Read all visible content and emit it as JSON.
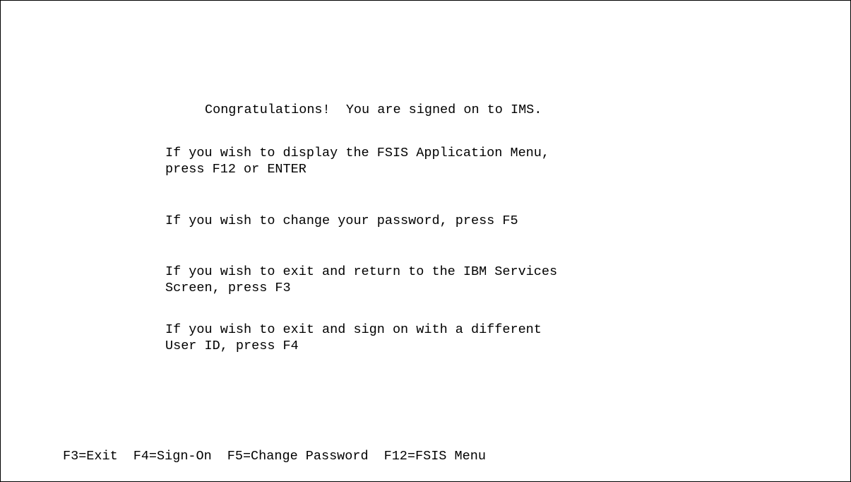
{
  "title": "Congratulations!  You are signed on to IMS.",
  "instructions": [
    {
      "line1": "If you wish to display the FSIS Application Menu,",
      "line2": "press F12 or ENTER"
    },
    {
      "line1": "If you wish to change your password, press F5",
      "line2": ""
    },
    {
      "line1": "If you wish to exit and return to the IBM Services",
      "line2": "Screen, press F3"
    },
    {
      "line1": "If you wish to exit and sign on with a different",
      "line2": "User ID, press F4"
    }
  ],
  "function_keys": [
    {
      "label": "F3=Exit"
    },
    {
      "label": "F4=Sign-On"
    },
    {
      "label": "F5=Change Password"
    },
    {
      "label": "F12=FSIS Menu"
    }
  ]
}
